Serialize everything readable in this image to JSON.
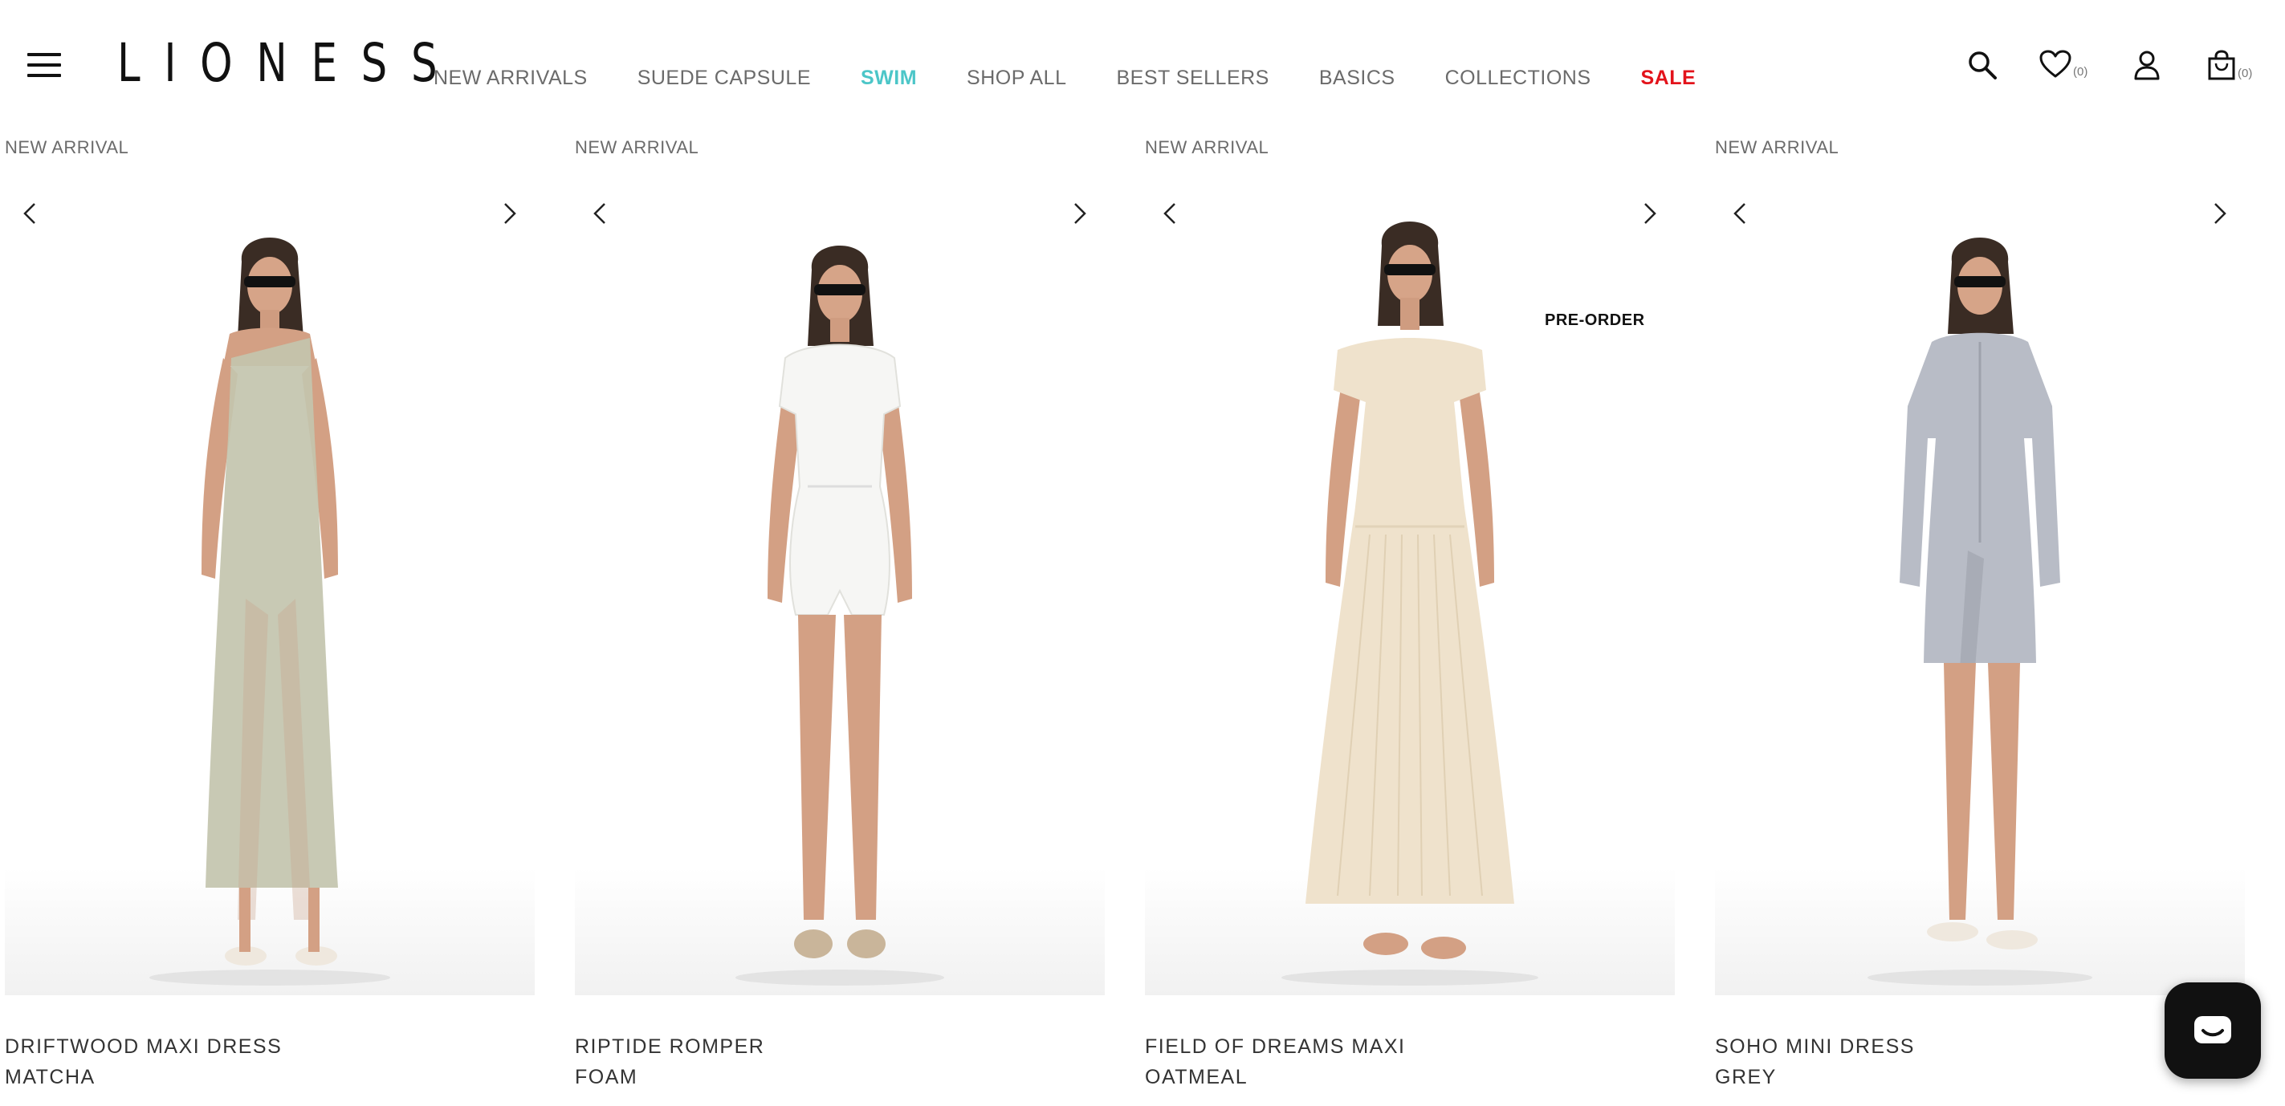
{
  "brand": {
    "logo_text": "LIONESS"
  },
  "nav": {
    "items": [
      {
        "label": "NEW ARRIVALS"
      },
      {
        "label": "SUEDE CAPSULE"
      },
      {
        "label": "SWIM",
        "color": "#4cc6c8"
      },
      {
        "label": "SHOP ALL"
      },
      {
        "label": "BEST SELLERS"
      },
      {
        "label": "BASICS"
      },
      {
        "label": "COLLECTIONS"
      },
      {
        "label": "SALE",
        "color": "#e3131b"
      }
    ]
  },
  "header_icons": {
    "search": "search-icon",
    "wishlist": {
      "icon": "heart-icon",
      "count": "(0)"
    },
    "account": "user-icon",
    "cart": {
      "icon": "bag-icon",
      "count": "(0)"
    }
  },
  "products": [
    {
      "badge": "NEW ARRIVAL",
      "name": "DRIFTWOOD MAXI DRESS",
      "color": "MATCHA",
      "garment_color": "#c3c4ae"
    },
    {
      "badge": "NEW ARRIVAL",
      "name": "RIPTIDE ROMPER",
      "color": "FOAM",
      "garment_color": "#f6f6f4"
    },
    {
      "badge": "NEW ARRIVAL",
      "name": "FIELD OF DREAMS MAXI",
      "color": "OATMEAL",
      "tag": "PRE-ORDER",
      "garment_color": "#efe2cc"
    },
    {
      "badge": "NEW ARRIVAL",
      "name": "SOHO MINI DRESS",
      "color": "GREY",
      "garment_color": "#b8bcc6"
    }
  ],
  "chat": {
    "icon": "chat-icon"
  }
}
